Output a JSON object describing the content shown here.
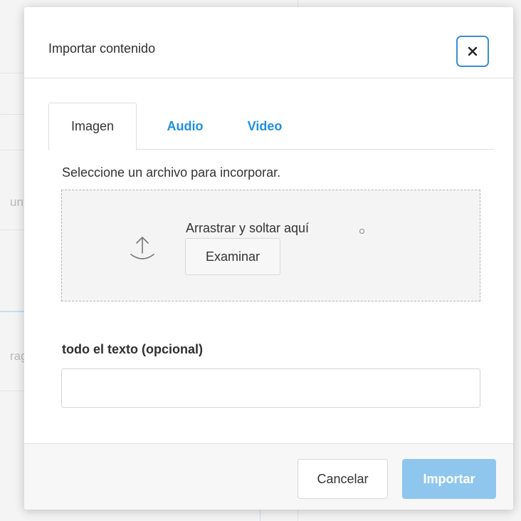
{
  "background": {
    "partial_text_1": "unt",
    "partial_text_2": "rag"
  },
  "modal": {
    "title": "Importar contenido",
    "close_icon": "close-icon"
  },
  "tabs": [
    {
      "label": "Imagen",
      "active": true
    },
    {
      "label": "Audio",
      "active": false
    },
    {
      "label": "Video",
      "active": false
    }
  ],
  "upload": {
    "instruction": "Seleccione un archivo para incorporar.",
    "drop_text": "Arrastrar y soltar aquí",
    "browse_label": "Examinar",
    "icon": "upload-icon"
  },
  "alt_text": {
    "label": "todo el texto (opcional)",
    "value": "",
    "placeholder": ""
  },
  "footer": {
    "cancel_label": "Cancelar",
    "import_label": "Importar",
    "import_enabled": false
  },
  "colors": {
    "accent": "#1f8fe0",
    "close_border": "#3a8fd6",
    "import_disabled": "#8fc6ee"
  }
}
